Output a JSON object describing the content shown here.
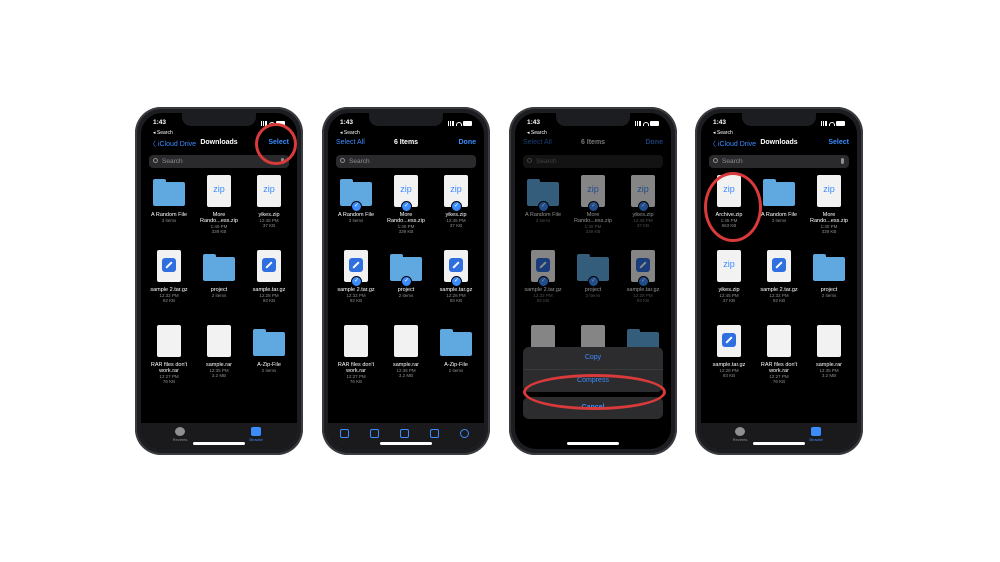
{
  "status_time": "1:43",
  "back_label": "◂ Search",
  "search_placeholder": "Search",
  "colors": {
    "accent": "#3b8cff",
    "highlight": "#d93a3a",
    "folder": "#5fa9e0"
  },
  "phone1": {
    "nav_left": "〈 iCloud Drive",
    "nav_title": "Downloads",
    "nav_right": "Select",
    "files": [
      {
        "name": "A Random File",
        "meta1": "3 items",
        "meta2": ""
      },
      {
        "name": "More Rando...ess.zip",
        "meta1": "1:40 PM",
        "meta2": "339 KB"
      },
      {
        "name": "yikes.zip",
        "meta1": "12:45 PM",
        "meta2": "37 KB"
      },
      {
        "name": "sample 2.tar.gz",
        "meta1": "12:32 PM",
        "meta2": "92 KB"
      },
      {
        "name": "project",
        "meta1": "2 items",
        "meta2": ""
      },
      {
        "name": "sample.tar.gz",
        "meta1": "12:28 PM",
        "meta2": "93 KB"
      },
      {
        "name": "RAR files don't work.rar",
        "meta1": "12:27 PM",
        "meta2": "76 KB"
      },
      {
        "name": "sample.rar",
        "meta1": "12:35 PM",
        "meta2": "3.2 MB"
      },
      {
        "name": "A-Zip-File",
        "meta1": "2 items",
        "meta2": ""
      }
    ],
    "tabs": {
      "recents": "Recents",
      "browse": "Browse"
    }
  },
  "phone2": {
    "nav_left": "Select All",
    "nav_title": "6 Items",
    "nav_right": "Done",
    "files": [
      {
        "name": "A Random File",
        "meta1": "3 items",
        "meta2": ""
      },
      {
        "name": "More Rando...ess.zip",
        "meta1": "1:40 PM",
        "meta2": "339 KB"
      },
      {
        "name": "yikes.zip",
        "meta1": "12:45 PM",
        "meta2": "37 KB"
      },
      {
        "name": "sample 2.tar.gz",
        "meta1": "12:32 PM",
        "meta2": "92 KB"
      },
      {
        "name": "project",
        "meta1": "2 items",
        "meta2": ""
      },
      {
        "name": "sample.tar.gz",
        "meta1": "12:28 PM",
        "meta2": "93 KB"
      },
      {
        "name": "RAR files don't work.rar",
        "meta1": "12:27 PM",
        "meta2": "76 KB"
      },
      {
        "name": "sample.rar",
        "meta1": "12:35 PM",
        "meta2": "3.2 MB"
      },
      {
        "name": "A-Zip-File",
        "meta1": "2 items",
        "meta2": ""
      }
    ]
  },
  "phone3": {
    "nav_left": "Select All",
    "nav_title": "6 Items",
    "nav_right": "Done",
    "files": [
      {
        "name": "A Random File",
        "meta1": "3 items",
        "meta2": ""
      },
      {
        "name": "More Rando...ess.zip",
        "meta1": "1:40 PM",
        "meta2": "339 KB"
      },
      {
        "name": "yikes.zip",
        "meta1": "12:45 PM",
        "meta2": "37 KB"
      },
      {
        "name": "sample 2.tar.gz",
        "meta1": "12:32 PM",
        "meta2": "92 KB"
      },
      {
        "name": "project",
        "meta1": "2 items",
        "meta2": ""
      },
      {
        "name": "sample.tar.gz",
        "meta1": "12:28 PM",
        "meta2": "93 KB"
      }
    ],
    "sheet": {
      "copy": "Copy",
      "compress": "Compress",
      "cancel": "Cancel"
    }
  },
  "phone4": {
    "nav_left": "〈 iCloud Drive",
    "nav_title": "Downloads",
    "nav_right": "Select",
    "files": [
      {
        "name": "Archive.zip",
        "meta1": "1:45 PM",
        "meta2": "563 KB"
      },
      {
        "name": "A Random File",
        "meta1": "3 items",
        "meta2": ""
      },
      {
        "name": "More Rando...ess.zip",
        "meta1": "1:40 PM",
        "meta2": "339 KB"
      },
      {
        "name": "yikes.zip",
        "meta1": "12:45 PM",
        "meta2": "37 KB"
      },
      {
        "name": "sample 2.tar.gz",
        "meta1": "12:32 PM",
        "meta2": "92 KB"
      },
      {
        "name": "project",
        "meta1": "2 items",
        "meta2": ""
      },
      {
        "name": "sample.tar.gz",
        "meta1": "12:28 PM",
        "meta2": "93 KB"
      },
      {
        "name": "RAR files don't work.rar",
        "meta1": "12:27 PM",
        "meta2": "76 KB"
      },
      {
        "name": "sample.rar",
        "meta1": "12:35 PM",
        "meta2": "3.2 MB"
      }
    ],
    "tabs": {
      "recents": "Recents",
      "browse": "Browse"
    }
  }
}
